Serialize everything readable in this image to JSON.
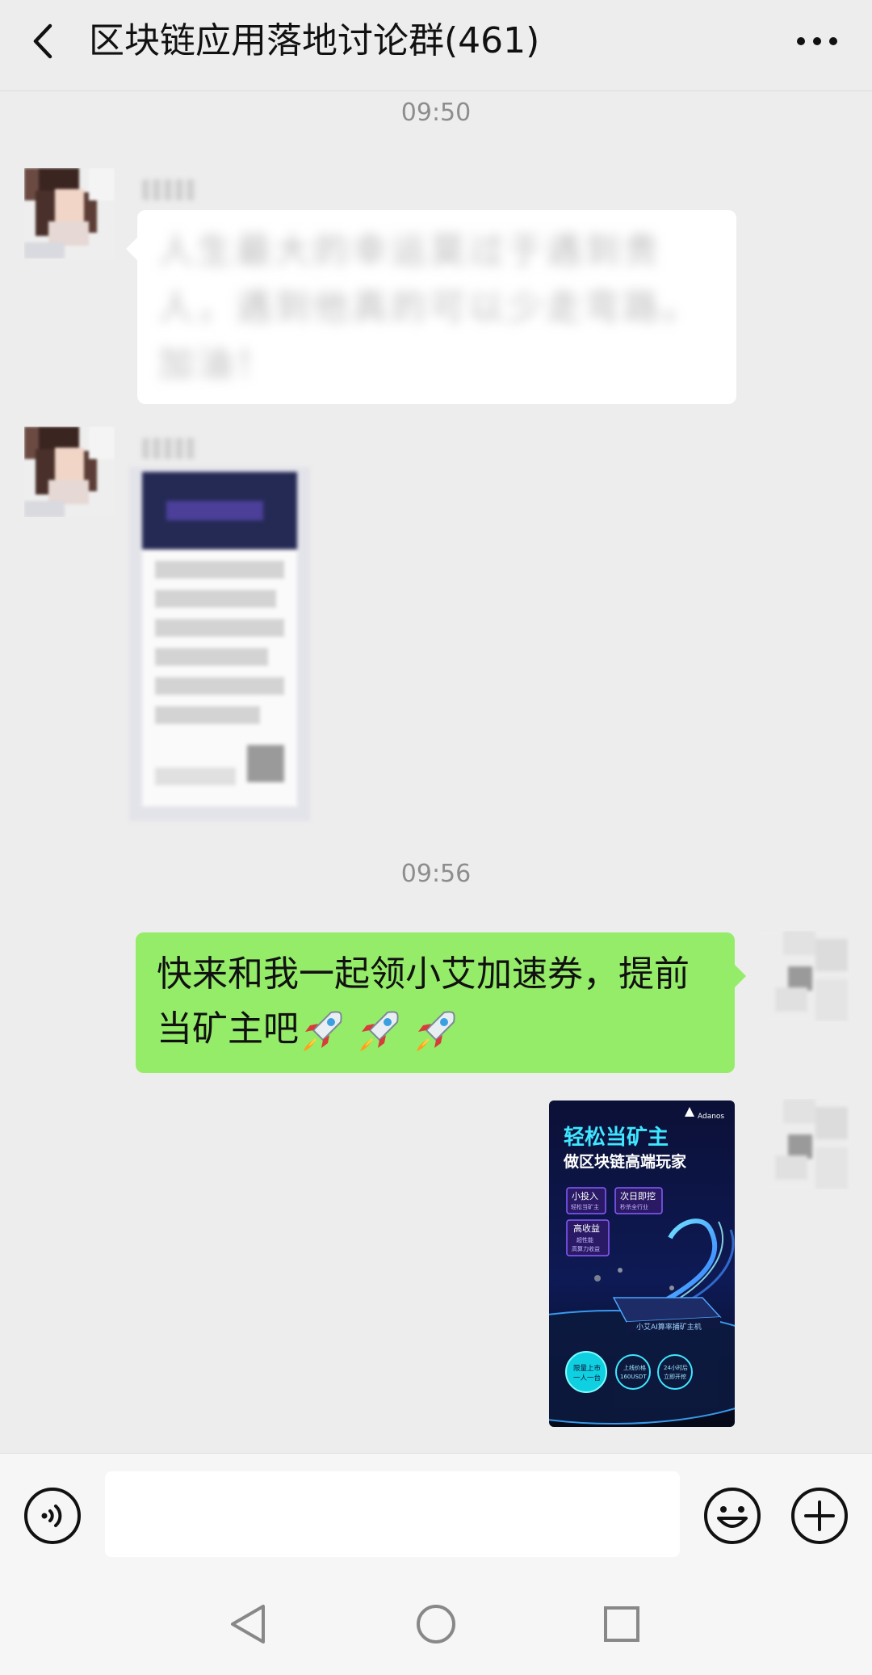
{
  "header": {
    "title": "区块链应用落地讨论群(461)"
  },
  "timestamps": [
    "09:50",
    "09:56"
  ],
  "messages": {
    "m1_text": "人生最大的幸运莫过于遇到贵人，遇到他真的可以少走弯路。加油！",
    "m3_text_line1": "快来和我一起领小艾加速券，提前",
    "m3_text_line2": "当矿主吧"
  },
  "poster": {
    "brand": "Adanos",
    "headline1": "轻松当矿主",
    "headline2": "做区块链高端玩家",
    "tag1_title": "小投入",
    "tag1_sub": "轻松当矿主",
    "tag2_title": "次日即挖",
    "tag2_sub": "秒杀全行业",
    "tag3_title": "高收益",
    "tag3_sub1": "超性能",
    "tag3_sub2": "高算力收益",
    "device_label": "小艾AI算率捕矿主机",
    "badge1_line1": "限量上市",
    "badge1_line2": "一人一台",
    "badge2_line1": "上线价格",
    "badge2_line2": "160USDT",
    "badge3_line1": "24小时后",
    "badge3_line2": "立即开挖"
  },
  "input": {
    "placeholder": ""
  },
  "icons": {
    "back": "chevron-left-icon",
    "more": "more-dots-icon",
    "voice": "voice-icon",
    "emoji": "emoji-icon",
    "plus": "plus-icon",
    "rocket": "rocket-icon"
  },
  "colors": {
    "background": "#ededed",
    "self_bubble": "#95ec69",
    "other_bubble": "#ffffff"
  }
}
